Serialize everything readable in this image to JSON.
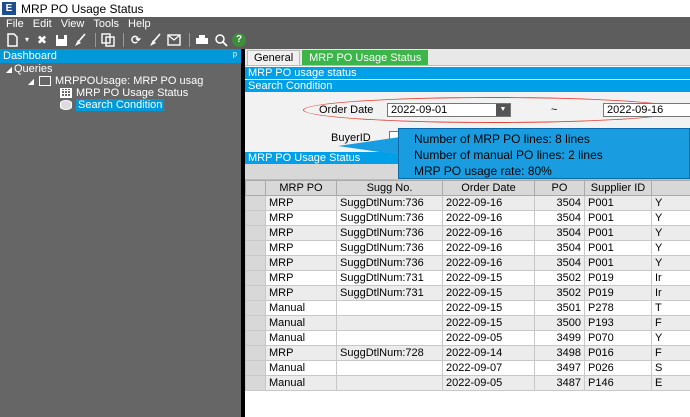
{
  "window": {
    "title": "MRP PO Usage Status",
    "app_icon": "E"
  },
  "menu": [
    "File",
    "Edit",
    "View",
    "Tools",
    "Help"
  ],
  "dashboard": {
    "title": "Dashboard",
    "pin": "ᵖ",
    "tree": {
      "root": "Queries",
      "query": "MRPPOUsage: MRP PO usag",
      "item1": "MRP PO Usage Status",
      "item2": "Search Condition"
    }
  },
  "tabs": [
    "General",
    "MRP PO Usage Status"
  ],
  "sections": {
    "usage_status": "MRP PO usage status",
    "search_condition": "Search Condition",
    "results": "MRP PO Usage Status"
  },
  "search": {
    "order_date_label": "Order Date",
    "date_from": "2022-09-01",
    "tilde": "~",
    "date_to": "2022-09-16",
    "buyer_label": "BuyerID"
  },
  "callout": {
    "line1": "Number of MRP PO lines: 8 lines",
    "line2": "Number of manual PO lines: 2 lines",
    "line3": "MRP PO usage rate: 80%"
  },
  "grid": {
    "columns": [
      "MRP PO",
      "Sugg No.",
      "Order Date",
      "PO",
      "Supplier ID",
      ""
    ],
    "rows": [
      [
        "MRP",
        "SuggDtlNum:736",
        "2022-09-16",
        "3504",
        "P001",
        "Y"
      ],
      [
        "MRP",
        "SuggDtlNum:736",
        "2022-09-16",
        "3504",
        "P001",
        "Y"
      ],
      [
        "MRP",
        "SuggDtlNum:736",
        "2022-09-16",
        "3504",
        "P001",
        "Y"
      ],
      [
        "MRP",
        "SuggDtlNum:736",
        "2022-09-16",
        "3504",
        "P001",
        "Y"
      ],
      [
        "MRP",
        "SuggDtlNum:736",
        "2022-09-16",
        "3504",
        "P001",
        "Y"
      ],
      [
        "MRP",
        "SuggDtlNum:731",
        "2022-09-15",
        "3502",
        "P019",
        "Ir"
      ],
      [
        "MRP",
        "SuggDtlNum:731",
        "2022-09-15",
        "3502",
        "P019",
        "Ir"
      ],
      [
        "Manual",
        "",
        "2022-09-15",
        "3501",
        "P278",
        "T"
      ],
      [
        "Manual",
        "",
        "2022-09-15",
        "3500",
        "P193",
        "F"
      ],
      [
        "Manual",
        "",
        "2022-09-05",
        "3499",
        "P070",
        "Y"
      ],
      [
        "MRP",
        "SuggDtlNum:728",
        "2022-09-14",
        "3498",
        "P016",
        "F"
      ],
      [
        "Manual",
        "",
        "2022-09-07",
        "3497",
        "P026",
        "S"
      ],
      [
        "Manual",
        "",
        "2022-09-05",
        "3487",
        "P146",
        "E"
      ]
    ]
  }
}
